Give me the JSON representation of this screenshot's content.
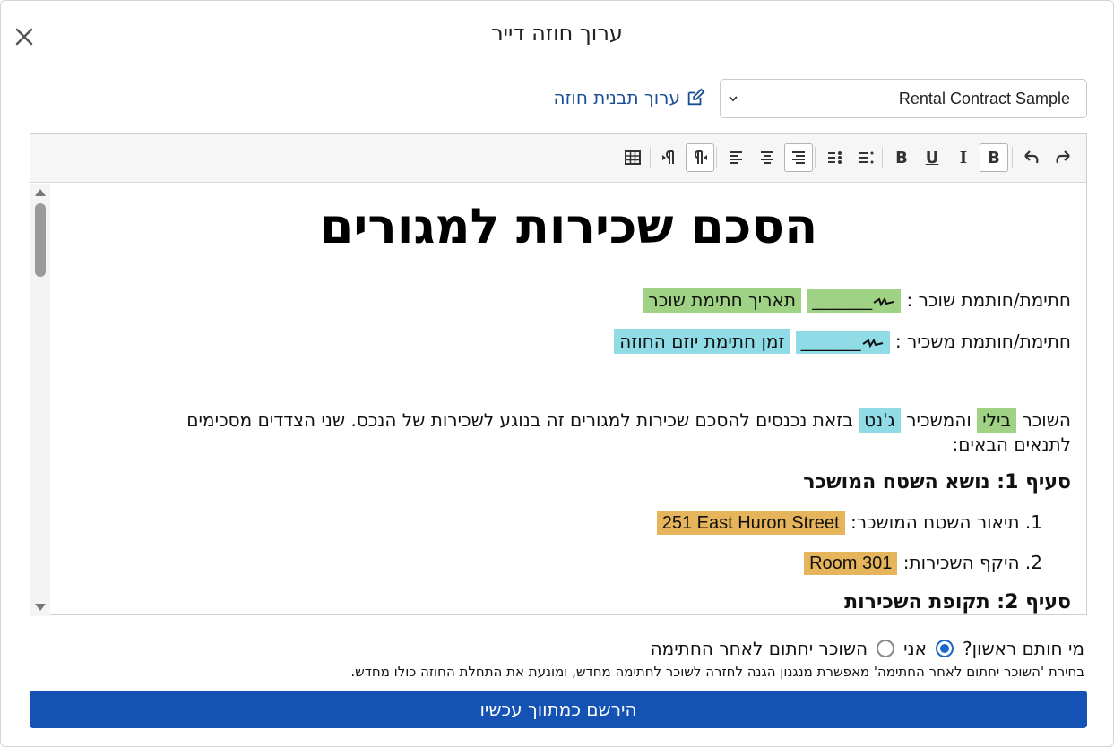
{
  "dialog": {
    "title": "ערוך חוזה דייר",
    "close_icon": "close-icon"
  },
  "template_select": {
    "value": "Rental Contract Sample",
    "icon": "chevron-down-icon"
  },
  "edit_template_link": {
    "label": "ערוך תבנית חוזה",
    "icon": "edit-icon",
    "color": "#1a4f96"
  },
  "toolbar": {
    "buttons": [
      "redo-icon",
      "undo-icon",
      "bold-icon",
      "italic-icon",
      "underline-icon",
      "bold-icon",
      "list-icon",
      "list-icon",
      "align-right-icon",
      "align-center-icon",
      "align-left-icon",
      "rtl-icon",
      "ltr-icon",
      "table-icon"
    ],
    "bold_label": "B",
    "italic_label": "I",
    "underline_label": "U"
  },
  "document": {
    "title": "הסכם שכירות למגורים",
    "tenant_sig": {
      "label": "חתימת/חותמת שוכר :",
      "blank": "______",
      "field": "תאריך חתימת שוכר"
    },
    "landlord_sig": {
      "label": "חתימת/חותמת משכיר :",
      "blank": "______",
      "field": "זמן חתימת יוזם החוזה"
    },
    "intro": {
      "p1": "השוכר",
      "tenant_name": "בילי",
      "p2": "והמשכיר",
      "landlord_name": "ג'נט",
      "p3": "בזאת נכנסים להסכם שכירות למגורים זה בנוגע לשכירות של הנכס. שני הצדדים מסכימים לתנאים הבאים:"
    },
    "section1": {
      "title": "סעיף 1: נושא השטח המושכר",
      "items": [
        {
          "num": "1.",
          "label": "תיאור השטח המושכר:",
          "value": "251 East Huron Street"
        },
        {
          "num": "2.",
          "label": "היקף השכירות:",
          "value": "Room 301"
        }
      ]
    },
    "section2": {
      "title": "סעיף 2: תקופת השכירות"
    },
    "highlight_colors": {
      "tenant": "#9fd284",
      "landlord": "#8fdbe6",
      "property": "#e6b45a"
    }
  },
  "signing": {
    "question": "מי חותם ראשון?",
    "options": [
      {
        "label": "אני",
        "selected": true
      },
      {
        "label": "השוכר יחתום לאחר החתימה",
        "selected": false
      }
    ],
    "hint": "בחירת 'השוכר יחתום לאחר החתימה' מאפשרת מנגנון הגנה לחזרה לשוכר לחתימה מחדש, ומונעת את התחלת החוזה כולו מחדש."
  },
  "submit_button": {
    "label": "הירשם כמתווך עכשיו",
    "color": "#1452b4"
  }
}
